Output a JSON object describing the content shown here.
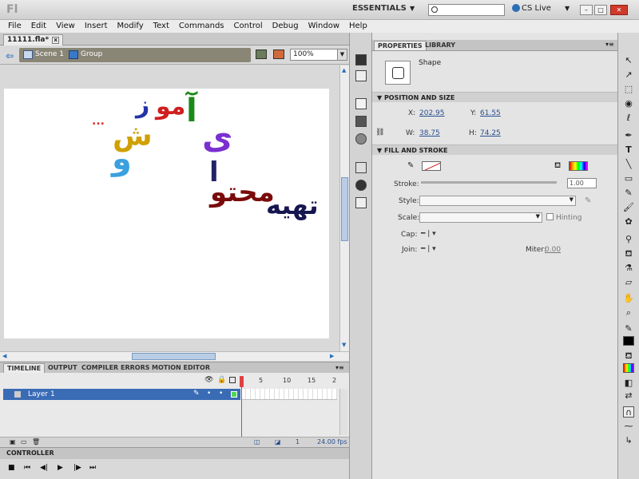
{
  "titlebar": {
    "logo": "Fl",
    "workspace": "ESSENTIALS",
    "search_placeholder": "",
    "cs_live": "CS Live"
  },
  "menu": [
    "File",
    "Edit",
    "View",
    "Insert",
    "Modify",
    "Text",
    "Commands",
    "Control",
    "Debug",
    "Window",
    "Help"
  ],
  "document_tab": {
    "label": "11111.fla*",
    "close": "x"
  },
  "editbar": {
    "scene": "Scene 1",
    "group": "Group",
    "zoom": "100%"
  },
  "artwork": {
    "glyph_1": "آ",
    "glyph_2": "مو",
    "glyph_3": "ز",
    "glyph_4": "ی",
    "glyph_5": "ا",
    "glyph_6": "ش",
    "glyph_7": "و",
    "glyph_8": "تهیه",
    "glyph_9": "محتو",
    "dots": "..."
  },
  "timeline": {
    "tabs": [
      "TIMELINE",
      "OUTPUT",
      "COMPILER ERRORS",
      "MOTION EDITOR"
    ],
    "ruler": [
      "5",
      "10",
      "15",
      "2"
    ],
    "layer_name": "Layer 1",
    "fps": "24.00 fps"
  },
  "controller": {
    "title": "CONTROLLER"
  },
  "properties": {
    "tabs": [
      "PROPERTIES",
      "LIBRARY"
    ],
    "instance_type": "Shape",
    "position_size": {
      "title": "POSITION AND SIZE",
      "x_label": "X:",
      "x_value": "202.95",
      "y_label": "Y:",
      "y_value": "61.55",
      "w_label": "W:",
      "w_value": "38.75",
      "h_label": "H:",
      "h_value": "74.25"
    },
    "fill_stroke": {
      "title": "FILL AND STROKE",
      "stroke_label": "Stroke:",
      "stroke_value": "1.00",
      "style_label": "Style:",
      "scale_label": "Scale:",
      "hinting_label": "Hinting",
      "cap_label": "Cap:",
      "join_label": "Join:",
      "miter_label": "Miter:",
      "miter_value": "0.00"
    }
  },
  "colors": {
    "accent_blue": "#3a6bb5",
    "playhead_red": "#e04040",
    "breadcrumb_bg": "#8a8676"
  }
}
